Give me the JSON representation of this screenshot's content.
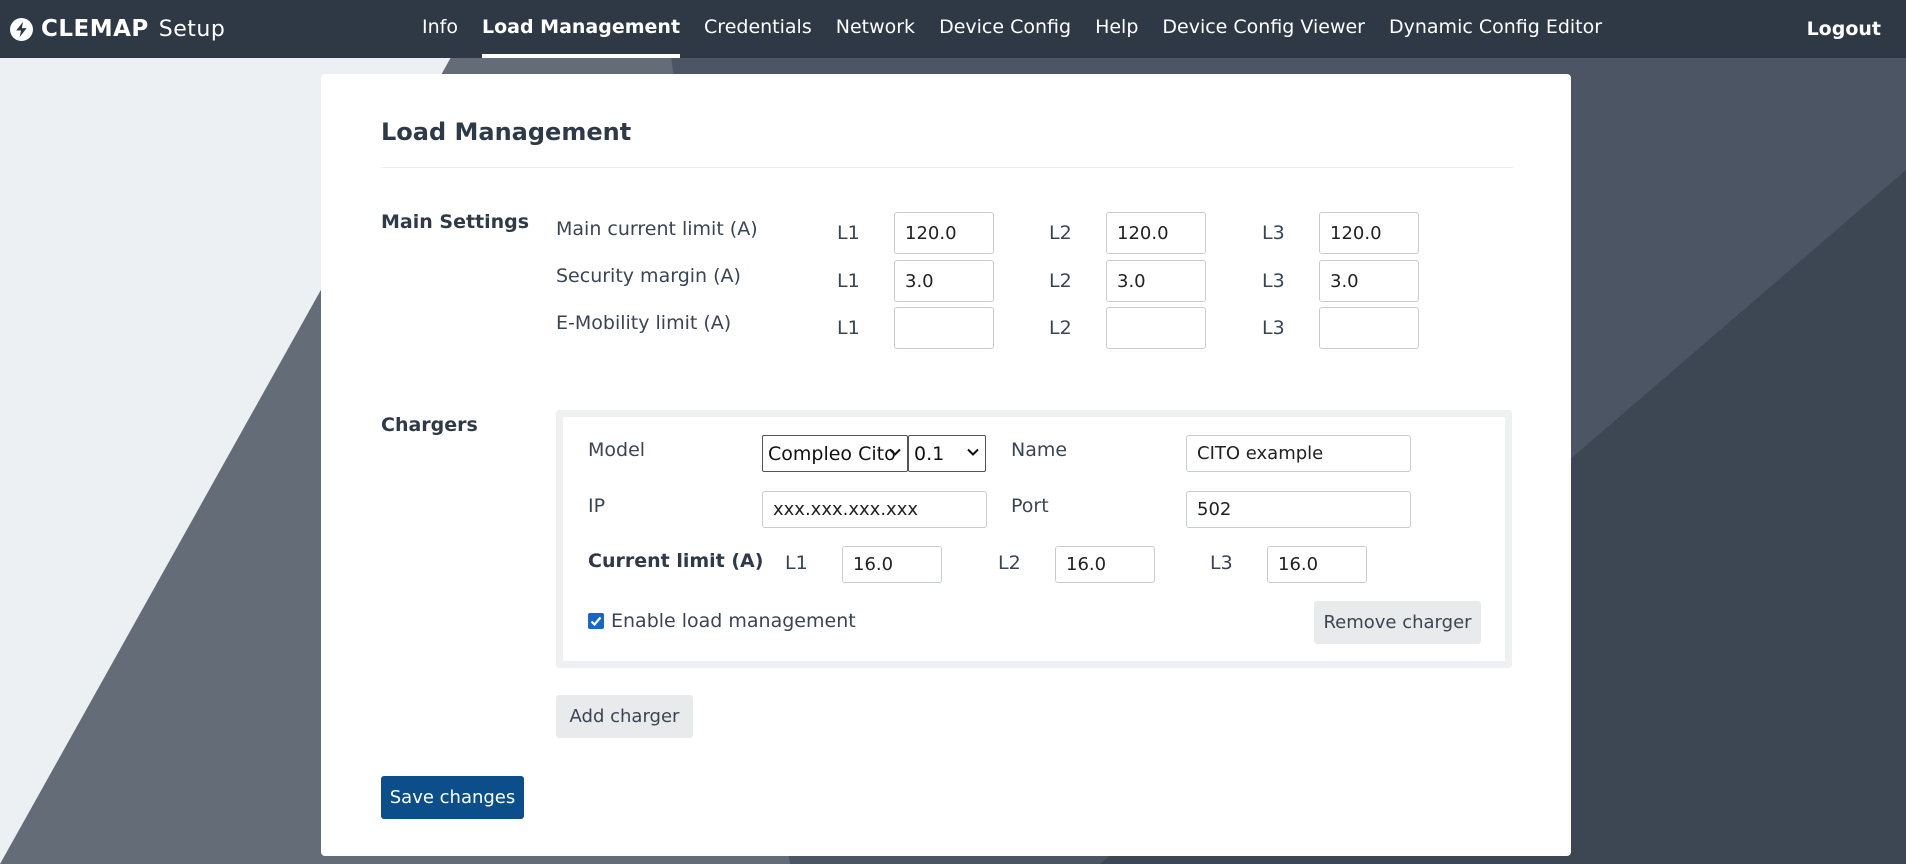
{
  "brand": {
    "name": "CLEMAP",
    "suffix": "Setup"
  },
  "nav": {
    "items": [
      {
        "label": "Info"
      },
      {
        "label": "Load Management",
        "active": true
      },
      {
        "label": "Credentials"
      },
      {
        "label": "Network"
      },
      {
        "label": "Device Config"
      },
      {
        "label": "Help"
      },
      {
        "label": "Device Config Viewer"
      },
      {
        "label": "Dynamic Config Editor"
      }
    ],
    "logout": "Logout"
  },
  "page": {
    "title": "Load Management"
  },
  "main_settings": {
    "label": "Main Settings",
    "rows": [
      {
        "label": "Main current limit (A)",
        "l1": "120.0",
        "l2": "120.0",
        "l3": "120.0"
      },
      {
        "label": "Security margin (A)",
        "l1": "3.0",
        "l2": "3.0",
        "l3": "3.0"
      },
      {
        "label": "E-Mobility limit (A)",
        "l1": "",
        "l2": "",
        "l3": ""
      }
    ],
    "phase_labels": [
      "L1",
      "L2",
      "L3"
    ]
  },
  "chargers": {
    "label": "Chargers",
    "charger": {
      "model_label": "Model",
      "model_value": "Compleo Cito",
      "version_value": "0.1",
      "name_label": "Name",
      "name_value": "CITO example",
      "ip_label": "IP",
      "ip_value": "xxx.xxx.xxx.xxx",
      "port_label": "Port",
      "port_value": "502",
      "current_limit_label": "Current limit (A)",
      "l1": "16.0",
      "l2": "16.0",
      "l3": "16.0",
      "enable_label": "Enable load management",
      "enable_checked": true,
      "remove_label": "Remove charger"
    },
    "add_label": "Add charger"
  },
  "save_label": "Save changes",
  "colors": {
    "navbar": "#2f3845",
    "primary": "#0c4e8a",
    "checkbox": "#1767c8"
  }
}
